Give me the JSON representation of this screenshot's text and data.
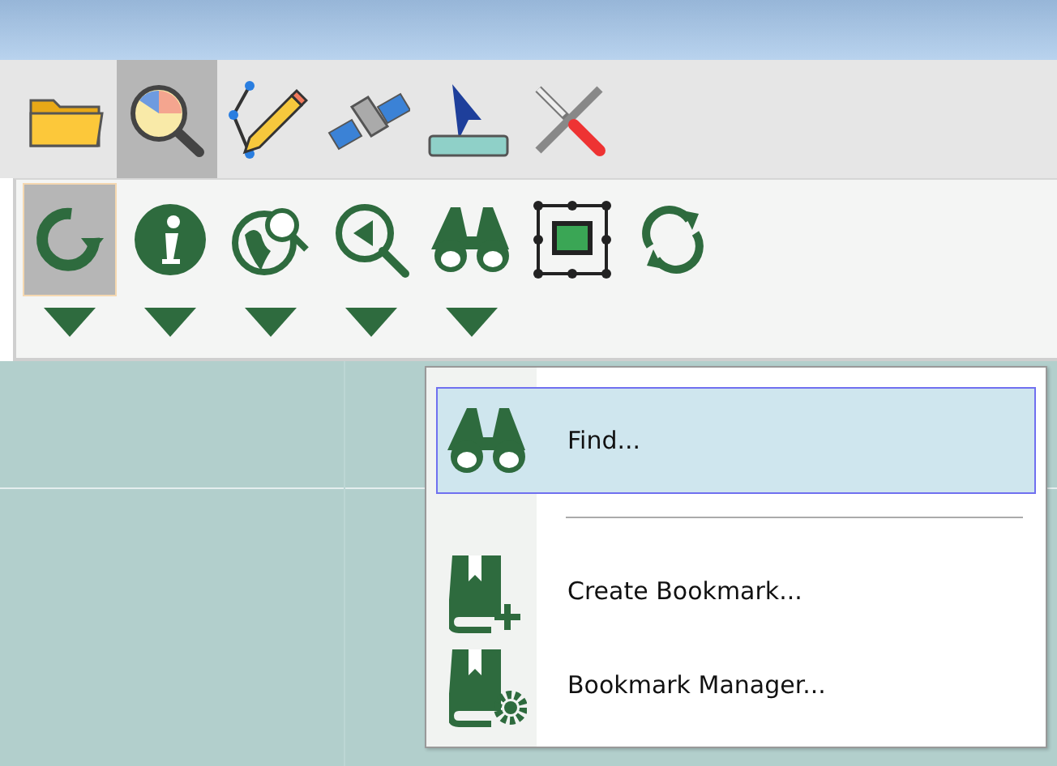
{
  "tabs": [
    {
      "kind": "folder",
      "selected": false
    },
    {
      "kind": "chart-search",
      "selected": true
    },
    {
      "kind": "edit",
      "selected": false
    },
    {
      "kind": "satellite",
      "selected": false
    },
    {
      "kind": "measure",
      "selected": false
    },
    {
      "kind": "tools",
      "selected": false
    }
  ],
  "toolbar": [
    {
      "kind": "refresh",
      "selected": true,
      "dropdown": true
    },
    {
      "kind": "info",
      "selected": false,
      "dropdown": true
    },
    {
      "kind": "globe-search",
      "selected": false,
      "dropdown": true
    },
    {
      "kind": "zoom-back",
      "selected": false,
      "dropdown": true
    },
    {
      "kind": "binoculars",
      "selected": false,
      "dropdown": true
    },
    {
      "kind": "extent",
      "selected": false,
      "dropdown": false
    },
    {
      "kind": "sync",
      "selected": false,
      "dropdown": false
    }
  ],
  "menu": [
    {
      "kind": "binoculars",
      "label": "Find...",
      "selected": true
    },
    {
      "kind": "separator"
    },
    {
      "kind": "bookmark-add",
      "label": "Create Bookmark...",
      "selected": false
    },
    {
      "kind": "bookmark-gear",
      "label": "Bookmark Manager...",
      "selected": false
    }
  ]
}
